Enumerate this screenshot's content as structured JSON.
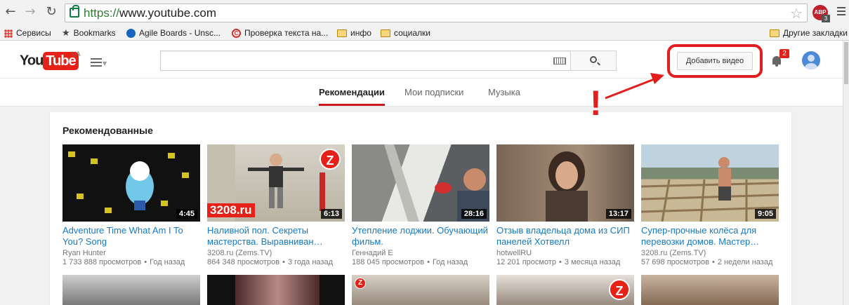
{
  "browser": {
    "url_scheme": "https://",
    "url_rest": "www.youtube.com",
    "abp_label": "ABP",
    "abp_count": "3",
    "icons": [
      "back-icon",
      "forward-icon",
      "reload-icon",
      "lock-icon",
      "star-icon",
      "adblock-icon",
      "menu-icon"
    ]
  },
  "bookmarks": {
    "items": [
      {
        "label": "Сервисы",
        "icon": "apps-icon"
      },
      {
        "label": "Bookmarks",
        "icon": "star-icon"
      },
      {
        "label": "Agile Boards - Unsc...",
        "icon": "agile-icon"
      },
      {
        "label": "Проверка текста на...",
        "icon": "copyright-icon"
      },
      {
        "label": "инфо",
        "icon": "folder-icon"
      },
      {
        "label": "социалки",
        "icon": "folder-icon"
      }
    ],
    "other": "Другие закладки"
  },
  "header": {
    "logo_you": "You",
    "logo_tube": "Tube",
    "region": "UA",
    "upload_label": "Добавить видео",
    "notification_count": "2",
    "accent_color": "#e62117"
  },
  "tabs": [
    {
      "label": "Рекомендации",
      "active": true
    },
    {
      "label": "Мои подписки",
      "active": false
    },
    {
      "label": "Музыка",
      "active": false
    }
  ],
  "section_title": "Рекомендованные",
  "annotation": {
    "mark": "!",
    "color": "#e41e1e"
  },
  "videos": [
    {
      "title": "Adventure Time What Am I To You? Song",
      "channel": "Ryan Hunter",
      "views": "1 733 888 просмотров",
      "age": "Год назад",
      "duration": "4:45"
    },
    {
      "title": "Наливной пол. Секреты мастерства. Выравниван…",
      "channel": "3208.ru (Zems.TV)",
      "views": "864 348 просмотров",
      "age": "3 года назад",
      "duration": "6:13",
      "brand": "3208.ru"
    },
    {
      "title": "Утепление лоджии. Обучающий фильм.",
      "channel": "Геннадий Е",
      "views": "188 045 просмотров",
      "age": "Год назад",
      "duration": "28:16"
    },
    {
      "title": "Отзыв владельца дома из СИП панелей Хотвелл",
      "channel": "hotwellRU",
      "views": "12 201 просмотр",
      "age": "3 месяца назад",
      "duration": "13:17"
    },
    {
      "title": "Супер-прочные колёса для перевозки домов. Мастер…",
      "channel": "3208.ru (Zems.TV)",
      "views": "57 698 просмотров",
      "age": "2 недели назад",
      "duration": "9:05"
    }
  ]
}
